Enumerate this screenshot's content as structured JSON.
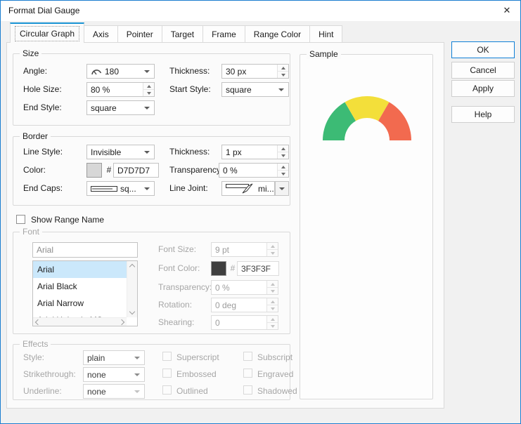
{
  "window": {
    "title": "Format Dial Gauge",
    "close_glyph": "✕"
  },
  "colors": {
    "dialog_border": "#1b7ed0",
    "tab_accent": "#1a94d4",
    "selection_bg": "#cbe8fb",
    "ok_border": "#0f7fd6"
  },
  "tabs": [
    {
      "label": "Circular Graph"
    },
    {
      "label": "Axis"
    },
    {
      "label": "Pointer"
    },
    {
      "label": "Target"
    },
    {
      "label": "Frame"
    },
    {
      "label": "Range Color"
    },
    {
      "label": "Hint"
    }
  ],
  "action_buttons": {
    "ok": "OK",
    "cancel": "Cancel",
    "apply": "Apply",
    "help": "Help"
  },
  "size_group": {
    "title": "Size",
    "angle": {
      "label": "Angle:",
      "value": "180"
    },
    "thickness": {
      "label": "Thickness:",
      "value": "30 px"
    },
    "hole_size": {
      "label": "Hole Size:",
      "value": "80 %"
    },
    "start_style": {
      "label": "Start Style:",
      "value": "square"
    },
    "end_style": {
      "label": "End Style:",
      "value": "square"
    }
  },
  "border_group": {
    "title": "Border",
    "line_style": {
      "label": "Line Style:",
      "value": "Invisible"
    },
    "thickness": {
      "label": "Thickness:",
      "value": "1 px"
    },
    "color": {
      "label": "Color:",
      "hash": "#",
      "value": "D7D7D7",
      "swatch": "#D7D7D7"
    },
    "transparency": {
      "label": "Transparency:",
      "value": "0 %"
    },
    "end_caps": {
      "label": "End Caps:",
      "value": "sq..."
    },
    "line_joint": {
      "label": "Line Joint:",
      "value": "mi..."
    }
  },
  "show_range_name": {
    "label": "Show Range Name",
    "checked": false
  },
  "font_group": {
    "title": "Font",
    "family_value": "Arial",
    "list": [
      "Arial",
      "Arial Black",
      "Arial Narrow",
      "Arial Unicode MS"
    ],
    "selected_index": 0,
    "font_size": {
      "label": "Font Size:",
      "value": "9 pt"
    },
    "font_color": {
      "label": "Font Color:",
      "hash": "#",
      "value": "3F3F3F",
      "swatch": "#3F3F3F"
    },
    "transparency": {
      "label": "Transparency:",
      "value": "0 %"
    },
    "rotation": {
      "label": "Rotation:",
      "value": "0 deg"
    },
    "shearing": {
      "label": "Shearing:",
      "value": "0"
    }
  },
  "effects_group": {
    "title": "Effects",
    "style": {
      "label": "Style:",
      "value": "plain"
    },
    "strikethrough": {
      "label": "Strikethrough:",
      "value": "none"
    },
    "underline": {
      "label": "Underline:",
      "value": "none"
    },
    "checkboxes": [
      "Superscript",
      "Subscript",
      "Embossed",
      "Engraved",
      "Outlined",
      "Shadowed"
    ]
  },
  "sample": {
    "title": "Sample",
    "gauge": {
      "type": "half-donut",
      "segments_deg": [
        60,
        60,
        60
      ],
      "green": "#3CBB75",
      "yellow": "#F3DF3A",
      "red": "#F26A4F"
    }
  }
}
